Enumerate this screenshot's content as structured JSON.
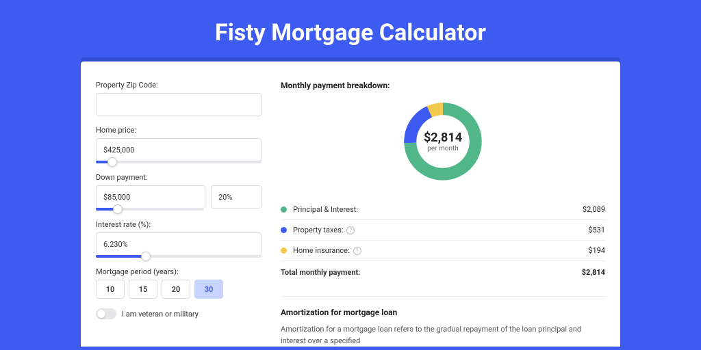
{
  "title": "Fisty Mortgage Calculator",
  "form": {
    "zip": {
      "label": "Property Zip Code:",
      "value": ""
    },
    "price": {
      "label": "Home price:",
      "value": "$425,000",
      "slider_pct": 10
    },
    "down": {
      "label": "Down payment:",
      "amount": "$85,000",
      "pct": "20%",
      "slider_pct": 20
    },
    "rate": {
      "label": "Interest rate (%):",
      "value": "6.230%",
      "slider_pct": 30
    },
    "period": {
      "label": "Mortgage period (years):",
      "options": [
        "10",
        "15",
        "20",
        "30"
      ],
      "active": "30"
    },
    "veteran": {
      "label": "I am veteran or military",
      "on": false
    }
  },
  "breakdown": {
    "title": "Monthly payment breakdown:",
    "total": "$2,814",
    "sub": "per month",
    "items": [
      {
        "label": "Principal & Interest:",
        "value": "$2,089",
        "color": "green"
      },
      {
        "label": "Property taxes:",
        "value": "$531",
        "color": "blue",
        "info": true
      },
      {
        "label": "Home insurance:",
        "value": "$194",
        "color": "yellow",
        "info": true
      }
    ],
    "total_row": {
      "label": "Total monthly payment:",
      "value": "$2,814"
    }
  },
  "amort": {
    "title": "Amortization for mortgage loan",
    "text": "Amortization for a mortgage loan refers to the gradual repayment of the loan principal and interest over a specified"
  },
  "chart_data": {
    "type": "pie",
    "title": "Monthly payment breakdown",
    "series": [
      {
        "name": "Principal & Interest",
        "value": 2089,
        "color": "#52b788"
      },
      {
        "name": "Property taxes",
        "value": 531,
        "color": "#3d5af1"
      },
      {
        "name": "Home insurance",
        "value": 194,
        "color": "#f2c94c"
      }
    ],
    "total": 2814,
    "center_label": "$2,814 per month"
  }
}
